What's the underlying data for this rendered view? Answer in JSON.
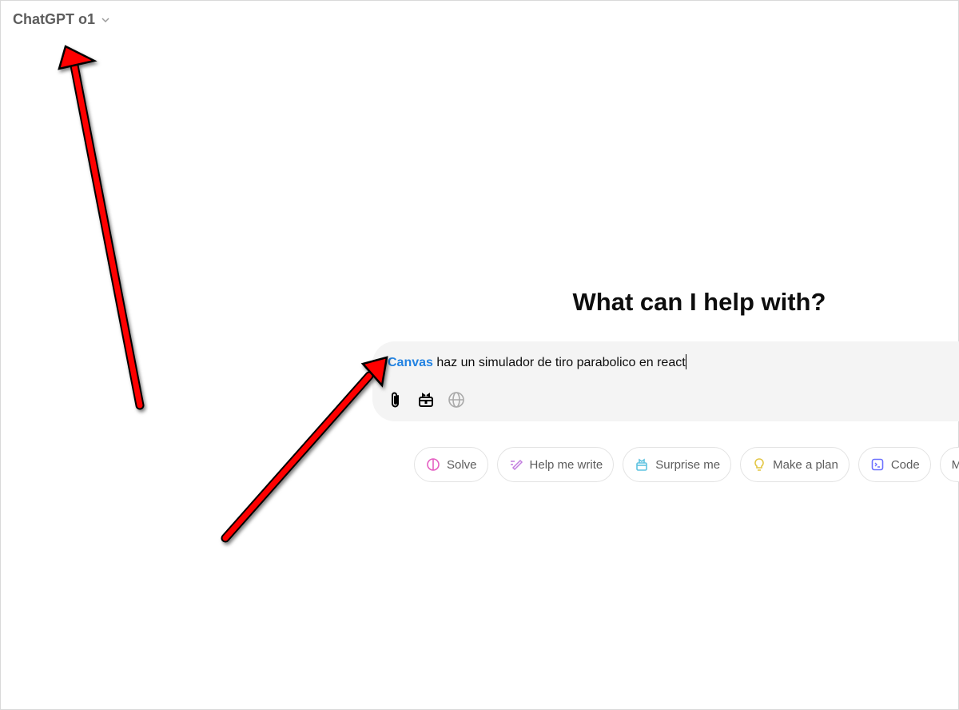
{
  "header": {
    "model_label": "ChatGPT o1",
    "model_dropdown_icon": "chevron-down-icon"
  },
  "main": {
    "heading": "What can I help with?"
  },
  "composer": {
    "tag": "Canvas",
    "text": " haz un simulador de tiro parabolico en react",
    "tools": [
      {
        "icon": "paperclip-icon"
      },
      {
        "icon": "toolbox-icon"
      },
      {
        "icon": "globe-icon"
      }
    ]
  },
  "chips": [
    {
      "label": "Solve",
      "icon": "brain-icon",
      "color": "#e55fc2"
    },
    {
      "label": "Help me write",
      "icon": "pen-icon",
      "color": "#c27ddf"
    },
    {
      "label": "Surprise me",
      "icon": "gift-icon",
      "color": "#5fc3e0"
    },
    {
      "label": "Make a plan",
      "icon": "lightbulb-icon",
      "color": "#e2c541"
    },
    {
      "label": "Code",
      "icon": "terminal-icon",
      "color": "#6c71ff"
    },
    {
      "label": "More",
      "icon": "",
      "color": "#5d5d5d"
    }
  ],
  "annotations": {
    "arrow_color": "#ff0000"
  }
}
